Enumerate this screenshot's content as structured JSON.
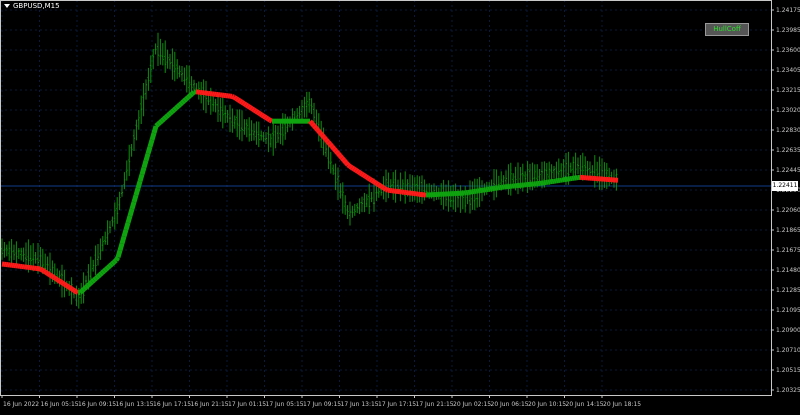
{
  "symbol": {
    "title": "GBPUSD,M15"
  },
  "hull_button": {
    "label": "HullCoff"
  },
  "current_price": "1.22411",
  "colors": {
    "background": "#000000",
    "grid": "#0a1a3a",
    "bar": "#0e8f0e",
    "hull_up": "#0fa30f",
    "hull_down": "#ff1a1a",
    "axis": "#c8c8c8",
    "current_price_line": "#123d8a"
  },
  "price_axis": {
    "labels": [
      "1.24175",
      "1.23985",
      "1.23600",
      "1.23405",
      "1.23215",
      "1.23020",
      "1.22830",
      "1.22635",
      "1.22445",
      "1.22250",
      "1.22060",
      "1.21865",
      "1.21675",
      "1.21480",
      "1.21285",
      "1.21095",
      "1.20900",
      "1.20710",
      "1.20515",
      "1.20325"
    ]
  },
  "time_axis": {
    "labels": [
      "16 Jun 2022",
      "16 Jun 05:15",
      "16 Jun 09:15",
      "16 Jun 13:15",
      "16 Jun 17:15",
      "16 Jun 21:15",
      "17 Jun 01:15",
      "17 Jun 05:15",
      "17 Jun 09:15",
      "17 Jun 13:15",
      "17 Jun 17:15",
      "17 Jun 21:15",
      "20 Jun 02:15",
      "20 Jun 06:15",
      "20 Jun 10:15",
      "20 Jun 14:15",
      "20 Jun 18:15"
    ]
  },
  "chart_data": {
    "type": "line",
    "title": "GBPUSD,M15",
    "xlabel": "",
    "ylabel": "",
    "ylim": [
      1.2027,
      1.2428
    ],
    "x": [
      "16 Jun 2022",
      "16 Jun 05:15",
      "16 Jun 09:15",
      "16 Jun 13:15",
      "16 Jun 17:15",
      "16 Jun 21:15",
      "17 Jun 01:15",
      "17 Jun 05:15",
      "17 Jun 09:15",
      "17 Jun 13:15",
      "17 Jun 17:15",
      "17 Jun 21:15",
      "20 Jun 02:15",
      "20 Jun 06:15",
      "20 Jun 10:15",
      "20 Jun 14:15",
      "20 Jun 18:15"
    ],
    "series": [
      {
        "values": [
          1.2175,
          1.2165,
          1.2125,
          1.2215,
          1.238,
          1.234,
          1.2305,
          1.2285,
          1.2325,
          1.221,
          1.224,
          1.2235,
          1.2225,
          1.2245,
          1.225,
          1.226,
          1.2245
        ]
      },
      {
        "values": [
          1.216,
          1.2155,
          1.213,
          1.2165,
          1.23,
          1.2335,
          1.233,
          1.2305,
          1.2305,
          1.226,
          1.2235,
          1.223,
          1.2232,
          1.2238,
          1.2242,
          1.2248,
          1.2245
        ]
      }
    ]
  }
}
